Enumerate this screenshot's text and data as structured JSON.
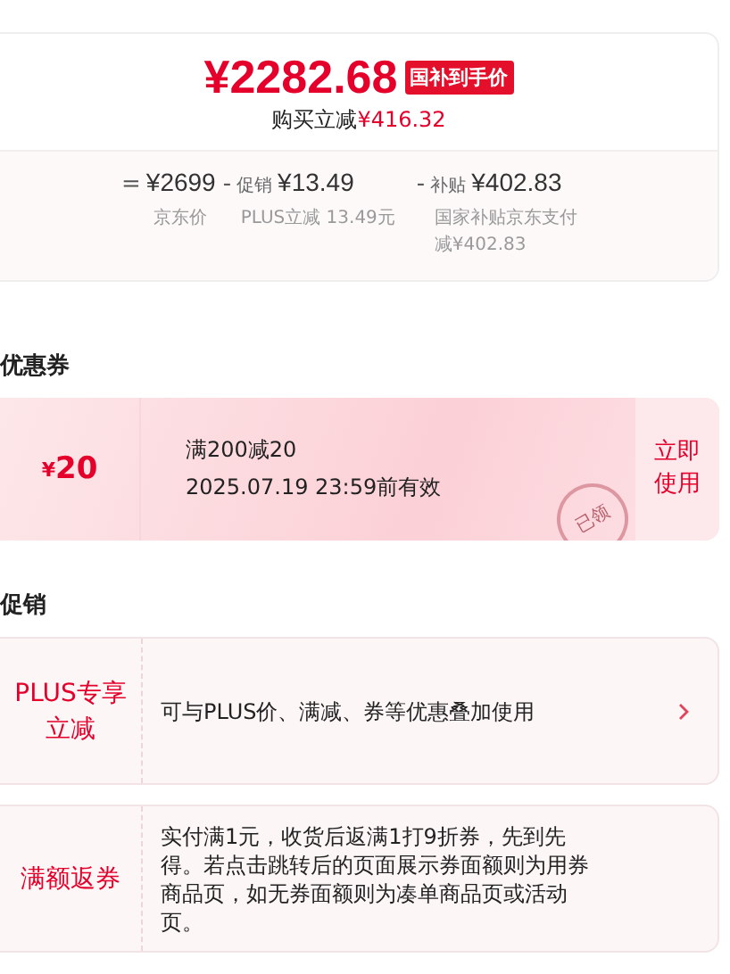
{
  "price_card": {
    "price": "¥2282.68",
    "price_tag": "国补到手价",
    "saving_label": "购买立减",
    "saving_amount": "¥416.32",
    "breakdown": [
      {
        "op": "=",
        "amount": "¥2699",
        "caption": "京东价"
      },
      {
        "op": "-",
        "prefix": "促销",
        "amount": "¥13.49",
        "caption": "PLUS立减 13.49元"
      },
      {
        "op": "-",
        "prefix": "补贴",
        "amount": "¥402.83",
        "caption": "国家补贴京东支付减¥402.83"
      }
    ]
  },
  "coupons": {
    "title": "优惠券",
    "items": [
      {
        "currency": "¥",
        "value": "20",
        "condition": "满200减20",
        "validity": "2025.07.19 23:59前有效",
        "action": "立即使用",
        "stamp": "已领"
      }
    ]
  },
  "promotions": {
    "title": "促销",
    "items": [
      {
        "label": "PLUS专享立减",
        "text": "可与PLUS价、满减、券等优惠叠加使用",
        "has_arrow": true
      },
      {
        "label": "满额返券",
        "text": "实付满1元，收货后返满1打9折券，先到先得。若点击跳转后的页面展示券面额则为用券商品页，如无券面额则为凑单商品页或活动页。",
        "has_arrow": false
      }
    ]
  }
}
